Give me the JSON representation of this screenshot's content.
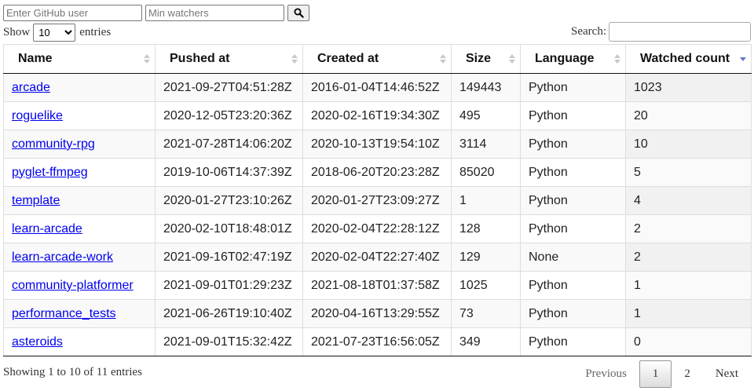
{
  "toolbar": {
    "user_placeholder": "Enter GitHub user",
    "watchers_placeholder": "Min watchers",
    "search_icon": "magnifier-icon"
  },
  "length": {
    "show_label": "Show",
    "selected": "10",
    "entries_label": "entries"
  },
  "filter": {
    "label": "Search:"
  },
  "table": {
    "columns": [
      "Name",
      "Pushed at",
      "Created at",
      "Size",
      "Language",
      "Watched count"
    ],
    "sorted_column": "Watched count",
    "sort_direction": "descending",
    "rows": [
      {
        "name": "arcade",
        "pushed": "2021-09-27T04:51:28Z",
        "created": "2016-01-04T14:46:52Z",
        "size": "149443",
        "language": "Python",
        "watched": "1023"
      },
      {
        "name": "roguelike",
        "pushed": "2020-12-05T23:20:36Z",
        "created": "2020-02-16T19:34:30Z",
        "size": "495",
        "language": "Python",
        "watched": "20"
      },
      {
        "name": "community-rpg",
        "pushed": "2021-07-28T14:06:20Z",
        "created": "2020-10-13T19:54:10Z",
        "size": "3114",
        "language": "Python",
        "watched": "10"
      },
      {
        "name": "pyglet-ffmpeg",
        "pushed": "2019-10-06T14:37:39Z",
        "created": "2018-06-20T20:23:28Z",
        "size": "85020",
        "language": "Python",
        "watched": "5"
      },
      {
        "name": "template",
        "pushed": "2020-01-27T23:10:26Z",
        "created": "2020-01-27T23:09:27Z",
        "size": "1",
        "language": "Python",
        "watched": "4"
      },
      {
        "name": "learn-arcade",
        "pushed": "2020-02-10T18:48:01Z",
        "created": "2020-02-04T22:28:12Z",
        "size": "128",
        "language": "Python",
        "watched": "2"
      },
      {
        "name": "learn-arcade-work",
        "pushed": "2021-09-16T02:47:19Z",
        "created": "2020-02-04T22:27:40Z",
        "size": "129",
        "language": "None",
        "watched": "2"
      },
      {
        "name": "community-platformer",
        "pushed": "2021-09-01T01:29:23Z",
        "created": "2021-08-18T01:37:58Z",
        "size": "1025",
        "language": "Python",
        "watched": "1"
      },
      {
        "name": "performance_tests",
        "pushed": "2021-06-26T19:10:40Z",
        "created": "2020-04-16T13:29:55Z",
        "size": "73",
        "language": "Python",
        "watched": "1"
      },
      {
        "name": "asteroids",
        "pushed": "2021-09-01T15:32:42Z",
        "created": "2021-07-23T16:56:05Z",
        "size": "349",
        "language": "Python",
        "watched": "0"
      }
    ]
  },
  "info": "Showing 1 to 10 of 11 entries",
  "pagination": {
    "previous": "Previous",
    "pages": [
      "1",
      "2"
    ],
    "current": "1",
    "next": "Next"
  },
  "colors": {
    "link": "#0000ee",
    "sort_active": "#6678c8",
    "sort_inactive": "#c8c8c8"
  }
}
